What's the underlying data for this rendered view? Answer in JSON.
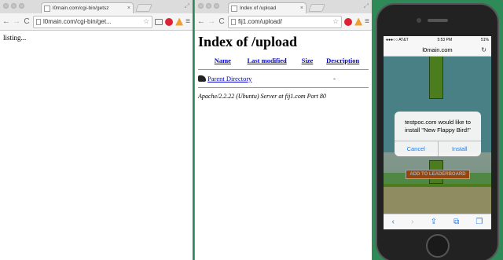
{
  "left_window": {
    "tab_title": "l0main.com/cgi-bin/getsz",
    "url": "l0main.com/cgi-bin/get...",
    "body_text": "listing..."
  },
  "middle_window": {
    "tab_title": "Index of /upload",
    "url": "fij1.com/upload/",
    "heading": "Index of /upload",
    "columns": [
      "Name",
      "Last modified",
      "Size",
      "Description"
    ],
    "rows": [
      {
        "name": "Parent Directory",
        "size": "-"
      }
    ],
    "address": "Apache/2.2.22 (Ubuntu) Server at fij1.com Port 80"
  },
  "phone": {
    "status": {
      "carrier": "●●●○○ AT&T",
      "time": "5:53 PM",
      "battery": "51%"
    },
    "safari_url": "l0main.com",
    "game_button": "ADD TO LEADERBOARD",
    "alert": {
      "message": "testpoc.com would like to install \"New Flappy Bird!\"",
      "cancel": "Cancel",
      "install": "Install"
    }
  },
  "icons": {
    "back": "←",
    "forward": "→",
    "reload": "C",
    "star": "☆",
    "menu": "≡",
    "expand": "⤢",
    "safari_back": "‹",
    "safari_forward": "›",
    "share": "⇪",
    "bookmarks": "⧉",
    "tabs": "❐"
  },
  "colors": {
    "link": "#0000cc",
    "ios_blue": "#1a7cf0",
    "desktop": "#2e8b57"
  }
}
